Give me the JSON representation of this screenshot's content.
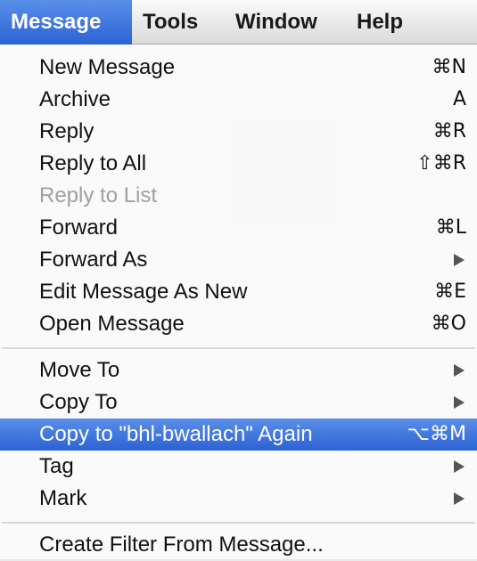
{
  "menubar": {
    "items": [
      "Message",
      "Tools",
      "Window",
      "Help"
    ]
  },
  "menu": {
    "items": [
      {
        "label": "New Message",
        "shortcut": "⌘N",
        "enabled": true
      },
      {
        "label": "Archive",
        "shortcut": "A",
        "enabled": true
      },
      {
        "label": "Reply",
        "shortcut": "⌘R",
        "enabled": true
      },
      {
        "label": "Reply to All",
        "shortcut": "⇧⌘R",
        "enabled": true
      },
      {
        "label": "Reply to List",
        "shortcut": "",
        "enabled": false
      },
      {
        "label": "Forward",
        "shortcut": "⌘L",
        "enabled": true
      },
      {
        "label": "Forward As",
        "shortcut": "",
        "enabled": true,
        "submenu": true
      },
      {
        "label": "Edit Message As New",
        "shortcut": "⌘E",
        "enabled": true
      },
      {
        "label": "Open Message",
        "shortcut": "⌘O",
        "enabled": true
      },
      {
        "label": "Move To",
        "shortcut": "",
        "enabled": true,
        "submenu": true
      },
      {
        "label": "Copy To",
        "shortcut": "",
        "enabled": true,
        "submenu": true
      },
      {
        "label": "Copy to \"bhl-bwallach\" Again",
        "shortcut": "⌥⌘M",
        "enabled": true,
        "selected": true
      },
      {
        "label": "Tag",
        "shortcut": "",
        "enabled": true,
        "submenu": true
      },
      {
        "label": "Mark",
        "shortcut": "",
        "enabled": true,
        "submenu": true
      },
      {
        "label": "Create Filter From Message...",
        "shortcut": "",
        "enabled": true
      }
    ]
  },
  "colors": {
    "highlight": "#3a74dc",
    "disabled_text": "#a0a0a0",
    "text": "#111111"
  }
}
